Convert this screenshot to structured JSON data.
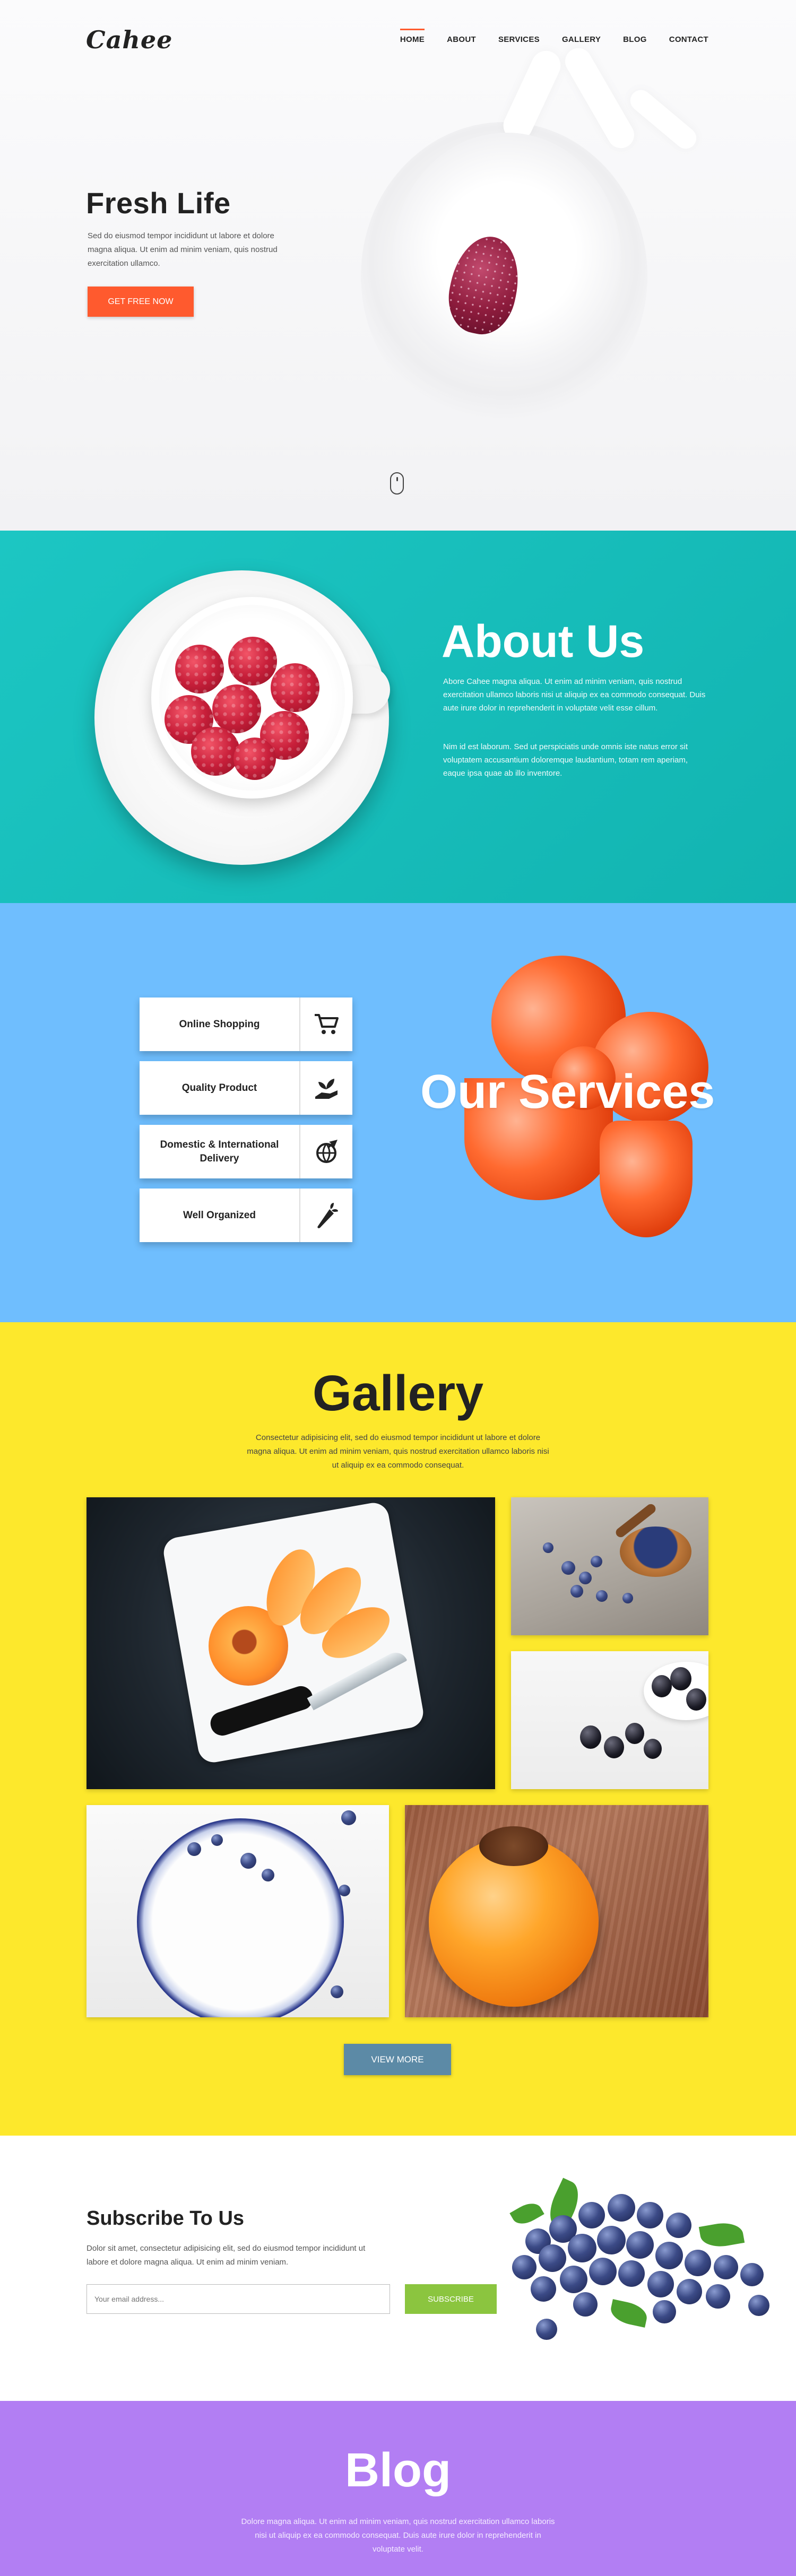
{
  "header": {
    "logo": "Cahee",
    "nav": [
      {
        "label": "HOME",
        "active": true
      },
      {
        "label": "ABOUT"
      },
      {
        "label": "SERVICES"
      },
      {
        "label": "GALLERY"
      },
      {
        "label": "BLOG"
      },
      {
        "label": "CONTACT"
      }
    ]
  },
  "hero": {
    "title": "Fresh Life",
    "text": "Sed do eiusmod tempor incididunt ut labore et dolore magna aliqua. Ut enim ad minim veniam, quis nostrud exercitation ullamco.",
    "button": "GET FREE NOW"
  },
  "about": {
    "title": "About Us",
    "p1": "Abore Cahee magna aliqua. Ut enim ad minim veniam, quis nostrud exercitation ullamco laboris nisi ut aliquip ex ea commodo consequat. Duis aute irure dolor in reprehenderit in voluptate velit esse cillum.",
    "p2": "Nim id est laborum. Sed ut perspiciatis unde omnis iste natus error sit voluptatem accusantium doloremque laudantium, totam rem aperiam, eaque ipsa quae ab illo inventore."
  },
  "services": {
    "title": "Our Services",
    "items": [
      {
        "label": "Online Shopping",
        "icon": "cart-icon"
      },
      {
        "label": "Quality Product",
        "icon": "hand-plant-icon"
      },
      {
        "label": "Domestic & International Delivery",
        "icon": "globe-plane-icon"
      },
      {
        "label": "Well Organized",
        "icon": "carrot-icon"
      }
    ]
  },
  "gallery": {
    "title": "Gallery",
    "text": "Consectetur adipisicing elit, sed do eiusmod tempor incididunt ut labore et dolore magna aliqua. Ut enim ad minim veniam, quis nostrud exercitation ullamco laboris nisi ut aliquip ex ea commodo consequat.",
    "button": "VIEW MORE"
  },
  "subscribe": {
    "title": "Subscribe To Us",
    "text": "Dolor sit amet, consectetur adipisicing elit, sed do eiusmod tempor incididunt ut labore et dolore magna aliqua. Ut enim ad minim veniam.",
    "placeholder": "Your email address...",
    "button": "SUBSCRIBE"
  },
  "blog": {
    "title": "Blog",
    "text": "Dolore magna aliqua. Ut enim ad minim veniam, quis nostrud exercitation ullamco laboris nisi ut aliquip ex ea commodo consequat. Duis aute irure dolor in reprehenderit in voluptate velit."
  },
  "colors": {
    "accent": "#ff5a2e",
    "about_bg": "#16bdb9",
    "services_bg": "#6fbefe",
    "gallery_bg": "#fde82c",
    "subscribe_btn": "#8bc53f",
    "view_more_btn": "#5c8aa6",
    "blog_bg": "#b27ef3"
  }
}
